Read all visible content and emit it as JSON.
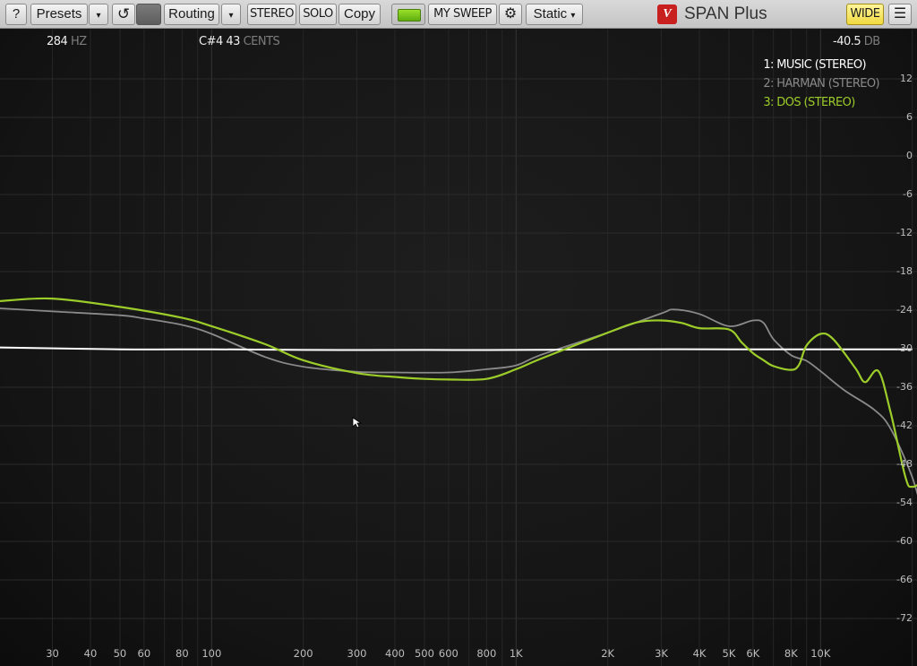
{
  "toolbar": {
    "help": "?",
    "presets": "Presets",
    "presets_arrow": "▾",
    "undo_icon": "↺",
    "routing": "Routing",
    "routing_arrow": "▾",
    "stereo": "STEREO",
    "solo": "SOLO",
    "copy": "Copy",
    "sweep": "MY SWEEP",
    "gear_icon": "⚙",
    "mode": "Static",
    "mode_arrow": "▾",
    "brand_logo": "V",
    "brand": "SPAN Plus",
    "wide": "WIDE",
    "menu_icon": "☰"
  },
  "readouts": {
    "freq_value": "284",
    "freq_unit": "HZ",
    "note": "C#4",
    "cents_value": "43",
    "cents_unit": "CENTS",
    "level_value": "-40.5",
    "level_unit": "DB"
  },
  "legend": [
    {
      "label": "1: MUSIC (STEREO)",
      "color": "#ffffff"
    },
    {
      "label": "2: HARMAN (STEREO)",
      "color": "#8a8a8a"
    },
    {
      "label": "3: DOS (STEREO)",
      "color": "#9ccc2a"
    }
  ],
  "colors": {
    "accent_green": "#9ccc2a",
    "toolbar_bg": "#cfcfcf",
    "plot_bg": "#161616",
    "grid": "#2b2b2b"
  },
  "y_labels": [
    "12",
    "6",
    "0",
    "-6",
    "-12",
    "-18",
    "-24",
    "-30",
    "-36",
    "-42",
    "-48",
    "-54",
    "-60",
    "-66",
    "-72"
  ],
  "x_labels": [
    "30",
    "40",
    "50",
    "60",
    "80",
    "100",
    "200",
    "300",
    "400",
    "500",
    "600",
    "800",
    "1K",
    "2K",
    "3K",
    "4K",
    "5K",
    "6K",
    "8K",
    "10K"
  ],
  "chart_data": {
    "type": "line",
    "x_scale": "log",
    "xlim": [
      20,
      20000
    ],
    "ylim": [
      -75,
      14
    ],
    "grid": true,
    "legend_position": "top-right",
    "series": [
      {
        "name": "1: MUSIC (STEREO)",
        "color": "#ffffff",
        "points": [
          [
            20,
            -29.8
          ],
          [
            50,
            -30.1
          ],
          [
            100,
            -30.1
          ],
          [
            200,
            -30.2
          ],
          [
            500,
            -30.2
          ],
          [
            1000,
            -30.2
          ],
          [
            2000,
            -30.1
          ],
          [
            5000,
            -30.1
          ],
          [
            10000,
            -30.1
          ],
          [
            20000,
            -30.1
          ]
        ]
      },
      {
        "name": "2: HARMAN (STEREO)",
        "color": "#8a8a8a",
        "points": [
          [
            20,
            -23.7
          ],
          [
            30,
            -24.2
          ],
          [
            50,
            -24.8
          ],
          [
            60,
            -25.3
          ],
          [
            80,
            -26.3
          ],
          [
            100,
            -27.7
          ],
          [
            150,
            -31.3
          ],
          [
            200,
            -32.8
          ],
          [
            300,
            -33.6
          ],
          [
            400,
            -33.7
          ],
          [
            600,
            -33.7
          ],
          [
            800,
            -33.2
          ],
          [
            1000,
            -32.6
          ],
          [
            1200,
            -31.0
          ],
          [
            2000,
            -27.5
          ],
          [
            3000,
            -24.5
          ],
          [
            3300,
            -23.9
          ],
          [
            4000,
            -24.6
          ],
          [
            5000,
            -26.5
          ],
          [
            6000,
            -25.6
          ],
          [
            6500,
            -26.0
          ],
          [
            7000,
            -28.5
          ],
          [
            8000,
            -31.0
          ],
          [
            9000,
            -31.9
          ],
          [
            10000,
            -33.5
          ],
          [
            12000,
            -36.5
          ],
          [
            15000,
            -39.5
          ],
          [
            17000,
            -42.5
          ],
          [
            20000,
            -50.0
          ],
          [
            22000,
            -57.0
          ]
        ]
      },
      {
        "name": "3: DOS (STEREO)",
        "color": "#9ccc2a",
        "points": [
          [
            20,
            -22.6
          ],
          [
            30,
            -22.2
          ],
          [
            50,
            -23.5
          ],
          [
            80,
            -25.2
          ],
          [
            100,
            -26.5
          ],
          [
            150,
            -29.3
          ],
          [
            200,
            -31.8
          ],
          [
            300,
            -33.8
          ],
          [
            400,
            -34.4
          ],
          [
            500,
            -34.7
          ],
          [
            600,
            -34.8
          ],
          [
            800,
            -34.7
          ],
          [
            1000,
            -33.2
          ],
          [
            1200,
            -31.6
          ],
          [
            2000,
            -27.5
          ],
          [
            2500,
            -25.9
          ],
          [
            3000,
            -25.6
          ],
          [
            3500,
            -26.0
          ],
          [
            4000,
            -26.8
          ],
          [
            5000,
            -27.0
          ],
          [
            5500,
            -29.0
          ],
          [
            6000,
            -30.7
          ],
          [
            6500,
            -31.8
          ],
          [
            7000,
            -32.7
          ],
          [
            8000,
            -33.3
          ],
          [
            8500,
            -32.5
          ],
          [
            9000,
            -29.5
          ],
          [
            10000,
            -27.7
          ],
          [
            11000,
            -28.5
          ],
          [
            13000,
            -33.0
          ],
          [
            14000,
            -35.2
          ],
          [
            15500,
            -33.5
          ],
          [
            17000,
            -40.0
          ],
          [
            19000,
            -50.0
          ],
          [
            20000,
            -51.5
          ],
          [
            22000,
            -50.5
          ]
        ]
      }
    ]
  }
}
